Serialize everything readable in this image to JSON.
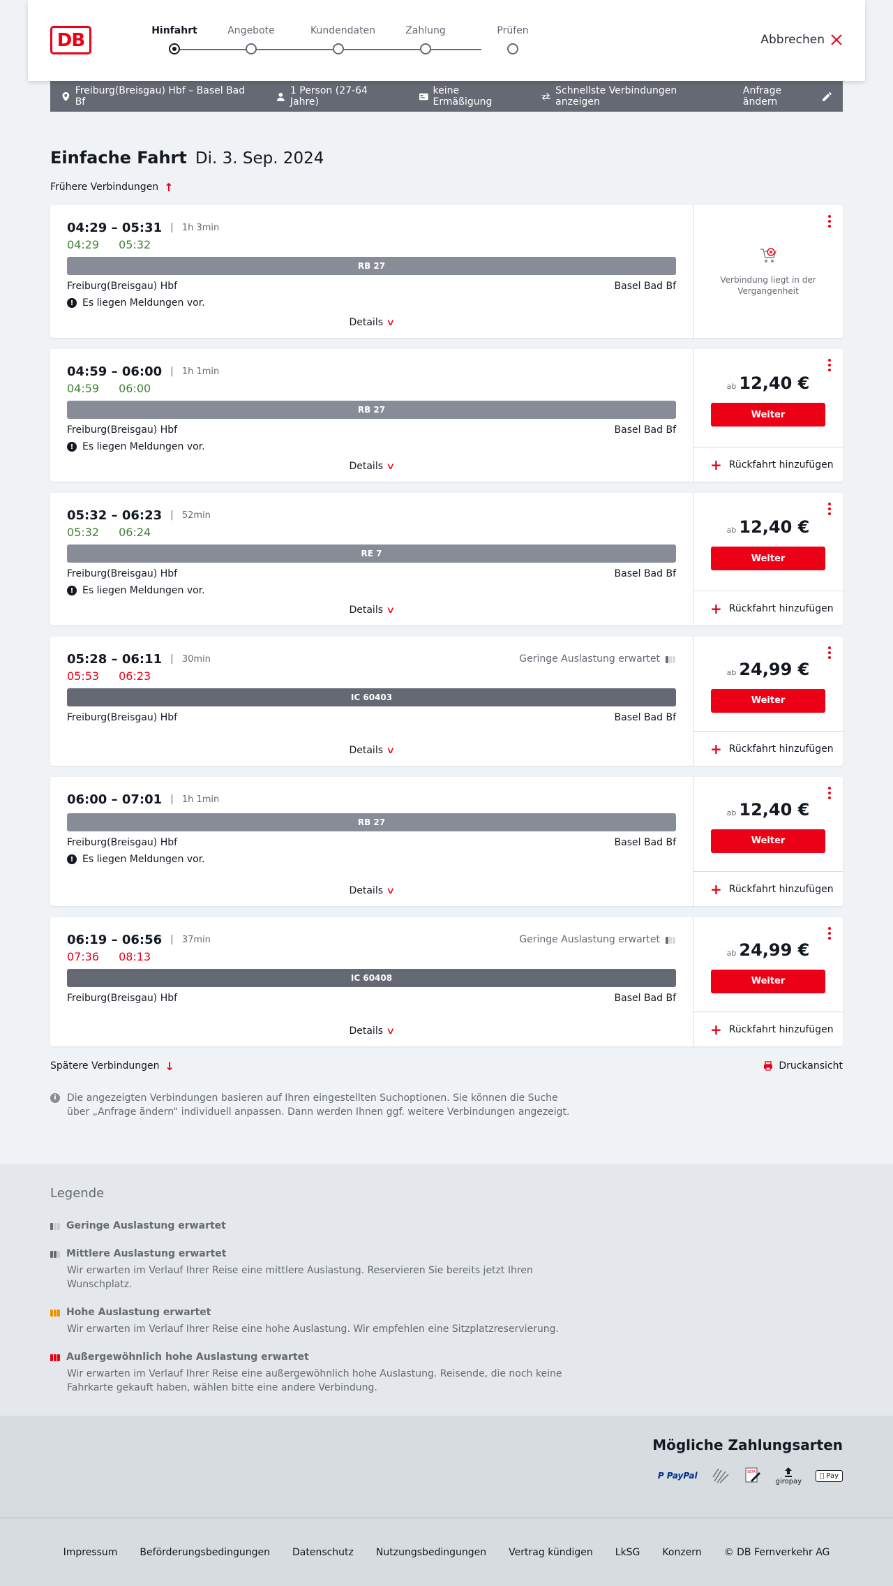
{
  "header": {
    "logo": "DB",
    "steps": [
      {
        "label": "Hinfahrt",
        "active": true
      },
      {
        "label": "Angebote",
        "active": false
      },
      {
        "label": "Kundendaten",
        "active": false
      },
      {
        "label": "Zahlung",
        "active": false
      },
      {
        "label": "Prüfen",
        "active": false
      }
    ],
    "cancel_label": "Abbrechen"
  },
  "query": {
    "route": "Freiburg(Breisgau) Hbf – Basel Bad Bf",
    "persons": "1 Person (27-64 Jahre)",
    "discount": "keine Ermäßigung",
    "fastest": "Schnellste Verbindungen anzeigen",
    "edit_label": "Anfrage ändern"
  },
  "title": {
    "main": "Einfache Fahrt",
    "date": "Di. 3. Sep. 2024"
  },
  "earlier_label": "Frühere Verbindungen",
  "later_label": "Spätere Verbindungen",
  "print_label": "Druckansicht",
  "connections": [
    {
      "times": "04:29 – 05:31",
      "duration": "1h 3min",
      "rt_dep": "04:29",
      "rt_arr": "05:32",
      "rt_status": "ok",
      "train": "RB 27",
      "train_type": "regional",
      "from": "Freiburg(Breisgau) Hbf",
      "to": "Basel Bad Bf",
      "notice": "Es liegen Meldungen vor.",
      "details": "Details",
      "past": true,
      "past_text": "Verbindung liegt in der Vergangenheit"
    },
    {
      "times": "04:59 – 06:00",
      "duration": "1h 1min",
      "rt_dep": "04:59",
      "rt_arr": "06:00",
      "rt_status": "ok",
      "train": "RB 27",
      "train_type": "regional",
      "from": "Freiburg(Breisgau) Hbf",
      "to": "Basel Bad Bf",
      "notice": "Es liegen Meldungen vor.",
      "details": "Details",
      "price_prefix": "ab",
      "price": "12,40 €",
      "button": "Weiter",
      "return": "Rückfahrt hinzufügen"
    },
    {
      "times": "05:32 – 06:23",
      "duration": "52min",
      "rt_dep": "05:32",
      "rt_arr": "06:24",
      "rt_status": "ok",
      "train": "RE 7",
      "train_type": "regional",
      "from": "Freiburg(Breisgau) Hbf",
      "to": "Basel Bad Bf",
      "notice": "Es liegen Meldungen vor.",
      "details": "Details",
      "price_prefix": "ab",
      "price": "12,40 €",
      "button": "Weiter",
      "return": "Rückfahrt hinzufügen"
    },
    {
      "times": "05:28 – 06:11",
      "duration": "30min",
      "occupancy": "Geringe Auslastung erwartet",
      "rt_dep": "05:53",
      "rt_arr": "06:23",
      "rt_status": "late",
      "train": "IC 60403",
      "train_type": "ic",
      "from": "Freiburg(Breisgau) Hbf",
      "to": "Basel Bad Bf",
      "details": "Details",
      "price_prefix": "ab",
      "price": "24,99 €",
      "button": "Weiter",
      "return": "Rückfahrt hinzufügen"
    },
    {
      "times": "06:00 – 07:01",
      "duration": "1h 1min",
      "train": "RB 27",
      "train_type": "regional",
      "from": "Freiburg(Breisgau) Hbf",
      "to": "Basel Bad Bf",
      "notice": "Es liegen Meldungen vor.",
      "details": "Details",
      "price_prefix": "ab",
      "price": "12,40 €",
      "button": "Weiter",
      "return": "Rückfahrt hinzufügen"
    },
    {
      "times": "06:19 – 06:56",
      "duration": "37min",
      "occupancy": "Geringe Auslastung erwartet",
      "rt_dep": "07:36",
      "rt_arr": "08:13",
      "rt_status": "late",
      "train": "IC 60408",
      "train_type": "ic",
      "from": "Freiburg(Breisgau) Hbf",
      "to": "Basel Bad Bf",
      "details": "Details",
      "price_prefix": "ab",
      "price": "24,99 €",
      "button": "Weiter",
      "return": "Rückfahrt hinzufügen"
    }
  ],
  "info_text": "Die angezeigten Verbindungen basieren auf Ihren eingestellten Suchoptionen. Sie können die Suche über „Anfrage ändern“ individuell anpassen. Dann werden Ihnen ggf. weitere Verbindungen angezeigt.",
  "legend": {
    "title": "Legende",
    "items": [
      {
        "level": "low",
        "title": "Geringe Auslastung erwartet",
        "desc": ""
      },
      {
        "level": "medium",
        "title": "Mittlere Auslastung erwartet",
        "desc": "Wir erwarten im Verlauf Ihrer Reise eine mittlere Auslastung. Reservieren Sie bereits jetzt Ihren Wunschplatz."
      },
      {
        "level": "high",
        "title": "Hohe Auslastung erwartet",
        "desc": "Wir erwarten im Verlauf Ihrer Reise eine hohe Auslastung. Wir empfehlen eine Sitzplatzreservierung."
      },
      {
        "level": "extreme",
        "title": "Außergewöhnlich hohe Auslastung erwartet",
        "desc": "Wir erwarten im Verlauf Ihrer Reise eine außergewöhnlich hohe Auslastung. Reisende, die noch keine Fahrkarte gekauft haben, wählen bitte eine andere Verbindung."
      }
    ]
  },
  "payment": {
    "title": "Mögliche Zahlungsarten",
    "methods": [
      {
        "name": "paypal",
        "label": "P PayPal"
      },
      {
        "name": "creditcard",
        "label": ""
      },
      {
        "name": "sepa",
        "label": "SEPA"
      },
      {
        "name": "giropay",
        "label": "giropay"
      },
      {
        "name": "applepay",
        "label": "Pay"
      }
    ]
  },
  "footer": {
    "links": [
      "Impressum",
      "Beförderungsbedingungen",
      "Datenschutz",
      "Nutzungsbedingungen",
      "Vertrag kündigen",
      "LkSG",
      "Konzern",
      "© DB Fernverkehr AG"
    ]
  },
  "colors": {
    "accent": "#ec0016",
    "on_time": "#408335",
    "late": "#ec0016",
    "bar": "#646973"
  }
}
